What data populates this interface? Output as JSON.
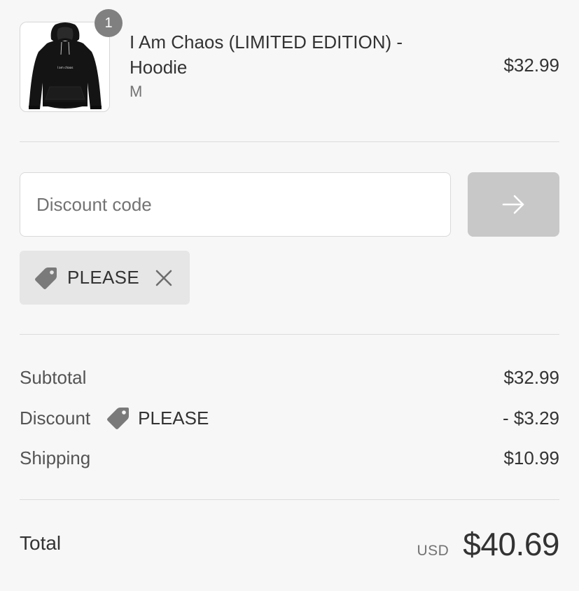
{
  "line_item": {
    "quantity": "1",
    "title": "I Am Chaos (LIMITED EDITION) - Hoodie",
    "variant": "M",
    "price": "$32.99",
    "image_print": "I am chaos"
  },
  "discount": {
    "placeholder": "Discount code",
    "value": "",
    "apply_icon": "arrow-right-icon",
    "applied_tag": {
      "icon": "tag-icon",
      "code": "PLEASE",
      "remove_icon": "close-icon"
    }
  },
  "totals": {
    "subtotal": {
      "label": "Subtotal",
      "value": "$32.99"
    },
    "discount": {
      "label": "Discount",
      "code": "PLEASE",
      "value": "- $3.29"
    },
    "shipping": {
      "label": "Shipping",
      "value": "$10.99"
    }
  },
  "grand_total": {
    "label": "Total",
    "currency": "USD",
    "amount": "$40.69"
  },
  "colors": {
    "background": "#f7f7f7",
    "text": "#333333",
    "muted_text": "#737373",
    "divider": "#dcdcdc",
    "apply_button": "#c8c8c8",
    "tag_chip": "#e6e6e6",
    "badge": "#808080",
    "tag_icon": "#7a7a7a"
  }
}
